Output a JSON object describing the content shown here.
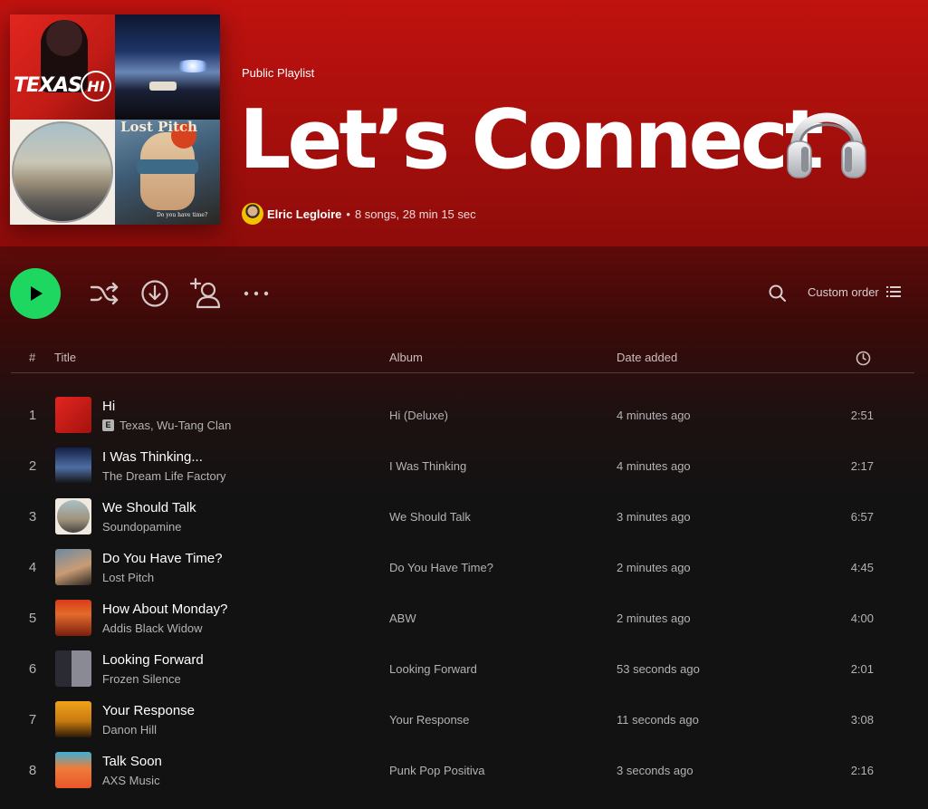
{
  "playlist": {
    "type": "Public Playlist",
    "title": "Let’s Connect",
    "owner": "Elric Legloire",
    "separator": "•",
    "stats": "8 songs, 28 min 15 sec",
    "cover": {
      "tile1_word": "TEXAS",
      "tile1_badge": "HI",
      "tile4_title": "Lost Pitch",
      "tile4_caption": "Do you have time?"
    }
  },
  "controls": {
    "sort_label": "Custom order"
  },
  "columns": {
    "num": "#",
    "title": "Title",
    "album": "Album",
    "date_added": "Date added"
  },
  "tracks": [
    {
      "num": "1",
      "title": "Hi",
      "artist": "Texas, Wu-Tang Clan",
      "explicit": "E",
      "album": "Hi (Deluxe)",
      "added": "4 minutes ago",
      "duration": "2:51"
    },
    {
      "num": "2",
      "title": "I Was Thinking...",
      "artist": "The Dream Life Factory",
      "album": "I Was Thinking",
      "added": "4 minutes ago",
      "duration": "2:17"
    },
    {
      "num": "3",
      "title": "We Should Talk",
      "artist": "Soundopamine",
      "album": "We Should Talk",
      "added": "3 minutes ago",
      "duration": "6:57"
    },
    {
      "num": "4",
      "title": "Do You Have Time?",
      "artist": "Lost Pitch",
      "album": "Do You Have Time?",
      "added": "2 minutes ago",
      "duration": "4:45"
    },
    {
      "num": "5",
      "title": "How About Monday?",
      "artist": "Addis Black Widow",
      "album": "ABW",
      "added": "2 minutes ago",
      "duration": "4:00"
    },
    {
      "num": "6",
      "title": "Looking Forward",
      "artist": "Frozen Silence",
      "album": "Looking Forward",
      "added": "53 seconds ago",
      "duration": "2:01"
    },
    {
      "num": "7",
      "title": "Your Response",
      "artist": "Danon Hill",
      "album": "Your Response",
      "added": "11 seconds ago",
      "duration": "3:08"
    },
    {
      "num": "8",
      "title": "Talk Soon",
      "artist": "AXS Music",
      "album": "Punk Pop Positiva",
      "added": "3 seconds ago",
      "duration": "2:16"
    }
  ],
  "colors": {
    "header": "#c0120f",
    "play_button": "#1ed760",
    "background": "#121212"
  },
  "icons": [
    "play-icon",
    "shuffle-icon",
    "download-icon",
    "add-user-icon",
    "more-icon",
    "search-icon",
    "list-icon",
    "clock-icon",
    "headphones-icon"
  ]
}
